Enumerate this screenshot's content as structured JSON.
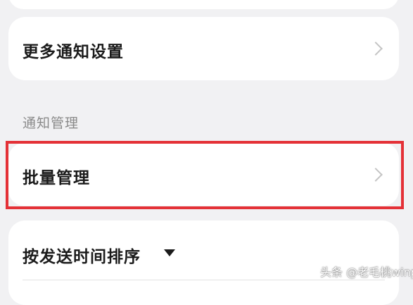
{
  "more_settings": {
    "label": "更多通知设置"
  },
  "section": {
    "title": "通知管理"
  },
  "batch_manage": {
    "label": "批量管理"
  },
  "sort": {
    "label": "按发送时间排序"
  },
  "watermark": {
    "text": "头条 @老毛桃winpe"
  },
  "colors": {
    "background": "#f1f1f3",
    "card": "#ffffff",
    "highlight": "#e43137",
    "section_text": "#8a8a8a",
    "primary_text": "#1b1b1b",
    "chevron": "#c4c4c4"
  },
  "icons": {
    "row_arrow": "chevron-right-icon",
    "sort_toggle": "caret-down-icon"
  }
}
